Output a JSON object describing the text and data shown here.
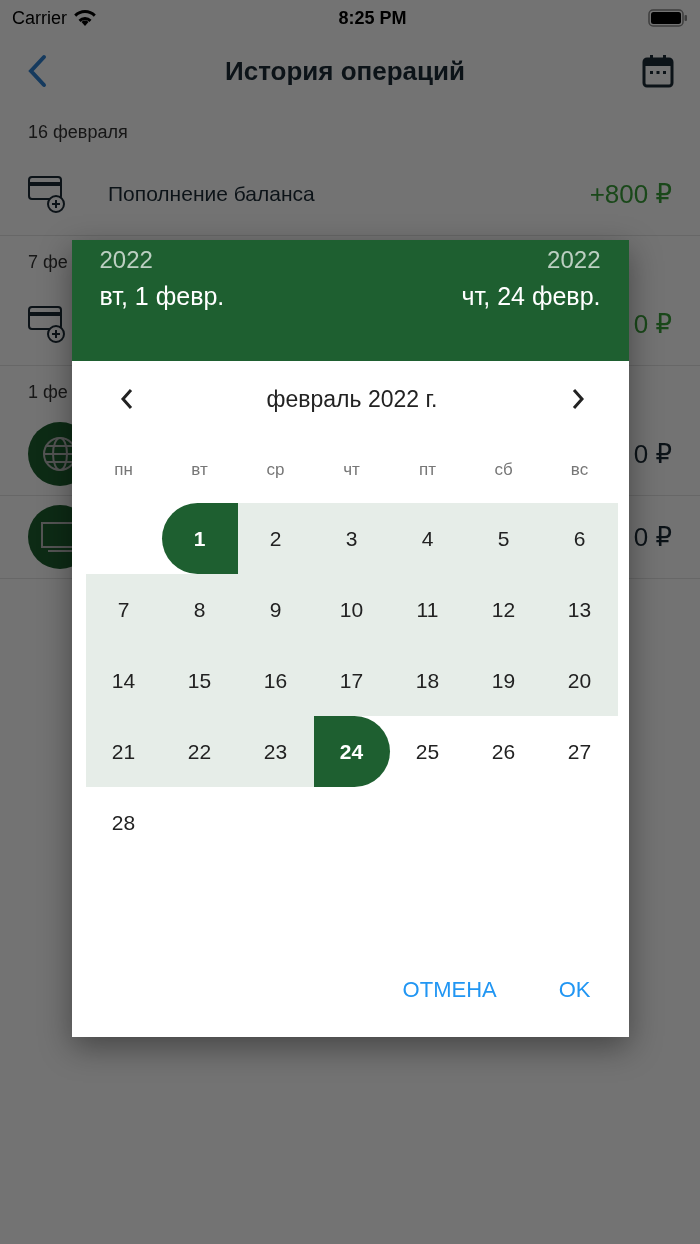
{
  "status_bar": {
    "carrier": "Carrier",
    "time": "8:25 PM"
  },
  "nav": {
    "title": "История операций"
  },
  "history": [
    {
      "date": "16 февраля",
      "items": [
        {
          "kind": "card",
          "label": "Пополнение баланса",
          "amount": "+800 ₽",
          "positive": true
        }
      ]
    },
    {
      "date": "7 фе",
      "items": [
        {
          "kind": "card",
          "amount": "0 ₽",
          "positive": true
        }
      ]
    },
    {
      "date": "1 фе",
      "items": [
        {
          "kind": "globe",
          "amount": "0 ₽",
          "positive": false
        },
        {
          "kind": "tv",
          "amount": "0 ₽",
          "positive": false
        }
      ]
    }
  ],
  "date_picker": {
    "start": {
      "year": "2022",
      "date": "вт, 1 февр."
    },
    "end": {
      "year": "2022",
      "date": "чт, 24 февр."
    },
    "month": "февраль 2022 г.",
    "weekdays": [
      "пн",
      "вт",
      "ср",
      "чт",
      "пт",
      "сб",
      "вс"
    ],
    "weeks": [
      [
        {
          "day": "1",
          "range_start": true,
          "range_end": false,
          "in_range": true
        },
        {
          "day": "2",
          "range_start": false,
          "range_end": false,
          "in_range": true
        },
        {
          "day": "3",
          "range_start": false,
          "range_end": false,
          "in_range": true
        },
        {
          "day": "4",
          "range_start": false,
          "range_end": false,
          "in_range": true
        },
        {
          "day": "5",
          "range_start": false,
          "range_end": false,
          "in_range": true
        },
        {
          "day": "6",
          "range_start": false,
          "range_end": false,
          "in_range": true
        }
      ],
      [
        {
          "day": "7",
          "range_start": false,
          "range_end": false,
          "in_range": true
        },
        {
          "day": "8",
          "range_start": false,
          "range_end": false,
          "in_range": true
        },
        {
          "day": "9",
          "range_start": false,
          "range_end": false,
          "in_range": true
        },
        {
          "day": "10",
          "range_start": false,
          "range_end": false,
          "in_range": true
        },
        {
          "day": "11",
          "range_start": false,
          "range_end": false,
          "in_range": true
        },
        {
          "day": "12",
          "range_start": false,
          "range_end": false,
          "in_range": true
        },
        {
          "day": "13",
          "range_start": false,
          "range_end": false,
          "in_range": true
        }
      ],
      [
        {
          "day": "14",
          "range_start": false,
          "range_end": false,
          "in_range": true
        },
        {
          "day": "15",
          "range_start": false,
          "range_end": false,
          "in_range": true
        },
        {
          "day": "16",
          "range_start": false,
          "range_end": false,
          "in_range": true
        },
        {
          "day": "17",
          "range_start": false,
          "range_end": false,
          "in_range": true
        },
        {
          "day": "18",
          "range_start": false,
          "range_end": false,
          "in_range": true
        },
        {
          "day": "19",
          "range_start": false,
          "range_end": false,
          "in_range": true
        },
        {
          "day": "20",
          "range_start": false,
          "range_end": false,
          "in_range": true
        }
      ],
      [
        {
          "day": "21",
          "range_start": false,
          "range_end": false,
          "in_range": true
        },
        {
          "day": "22",
          "range_start": false,
          "range_end": false,
          "in_range": true
        },
        {
          "day": "23",
          "range_start": false,
          "range_end": false,
          "in_range": true
        },
        {
          "day": "24",
          "range_start": false,
          "range_end": true,
          "in_range": true
        },
        {
          "day": "25",
          "range_start": false,
          "range_end": false,
          "in_range": false
        },
        {
          "day": "26",
          "range_start": false,
          "range_end": false,
          "in_range": false
        },
        {
          "day": "27",
          "range_start": false,
          "range_end": false,
          "in_range": false
        }
      ],
      [
        {
          "day": "28",
          "range_start": false,
          "range_end": false,
          "in_range": false
        }
      ]
    ],
    "buttons": [
      "ОТМЕНА",
      "OK"
    ]
  }
}
